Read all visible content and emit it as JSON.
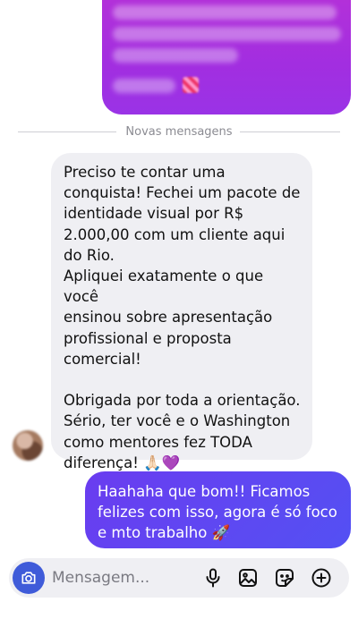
{
  "divider": {
    "label": "Novas mensagens"
  },
  "incoming_message": {
    "paragraph1": "Preciso te contar uma\nconquista! Fechei um pacote de\nidentidade visual por R$\n2.000,00 com um cliente aqui\ndo Rio.",
    "paragraph2": "Apliquei exatamente o que você\nensinou sobre apresentação\nprofissional e proposta\ncomercial!",
    "paragraph3": "Obrigada por toda a orientação.\nSério, ter você e o Washington\ncomo mentores fez TODA\ndiferença! 🙏🏻💜"
  },
  "outgoing_message": {
    "text": "Haahaha que bom!! Ficamos\nfelizes com isso, agora é só foco\ne mto trabalho 🚀"
  },
  "composer": {
    "placeholder": "Mensagem..."
  },
  "icons": {
    "camera": "camera-icon",
    "mic": "microphone-icon",
    "gallery": "image-icon",
    "sticker": "sticker-icon",
    "add": "plus-circle-icon"
  },
  "colors": {
    "outgoing_bubble": "#5d49f2",
    "incoming_bubble": "#efeff3",
    "camera_button": "#3f5bd9",
    "top_bubble": "#a22ee0"
  }
}
